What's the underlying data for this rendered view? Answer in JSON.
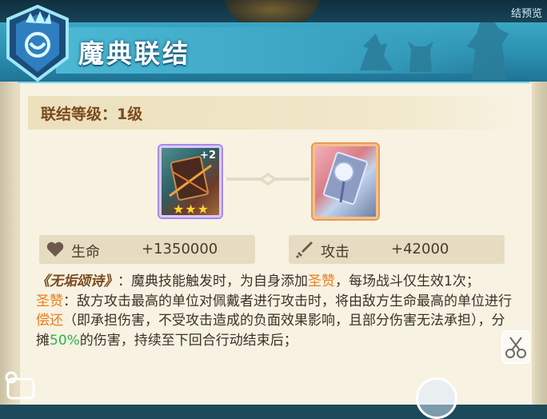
{
  "top": {
    "right_label": "结预览"
  },
  "header": {
    "title": "魔典联结"
  },
  "level": {
    "label": "联结等级：1级"
  },
  "cards": [
    {
      "name": "grimoire-card-1",
      "plus": "+2",
      "stars": "★★★"
    },
    {
      "name": "grimoire-card-2"
    }
  ],
  "stats": [
    {
      "icon": "heart-icon",
      "label": "生命",
      "value": "+1350000"
    },
    {
      "icon": "sword-icon",
      "label": "攻击",
      "value": "+42000"
    }
  ],
  "description": {
    "skill_name": "《无垢颂诗》",
    "line1_a": "：魔典技能触发时，为自身添加",
    "term1": "圣赞",
    "line1_b": "，每场战斗仅生效1次；",
    "term2": "圣赞",
    "line2_a": "：敌方攻击最高的单位对佩戴者进行攻击时，将由敌方生命最高的单位进行",
    "term3": "偿还",
    "line2_b": "（即承担伤害，不受攻击造成的负面效果影响，且部分伤害无法承担），分摊",
    "percent": "50%",
    "line2_c": "的伤害，持续至下回合行动结束后；"
  },
  "colors": {
    "accent_orange": "#ea7d1e",
    "accent_green": "#2fb24a",
    "title_brown": "#7b4a1e"
  }
}
